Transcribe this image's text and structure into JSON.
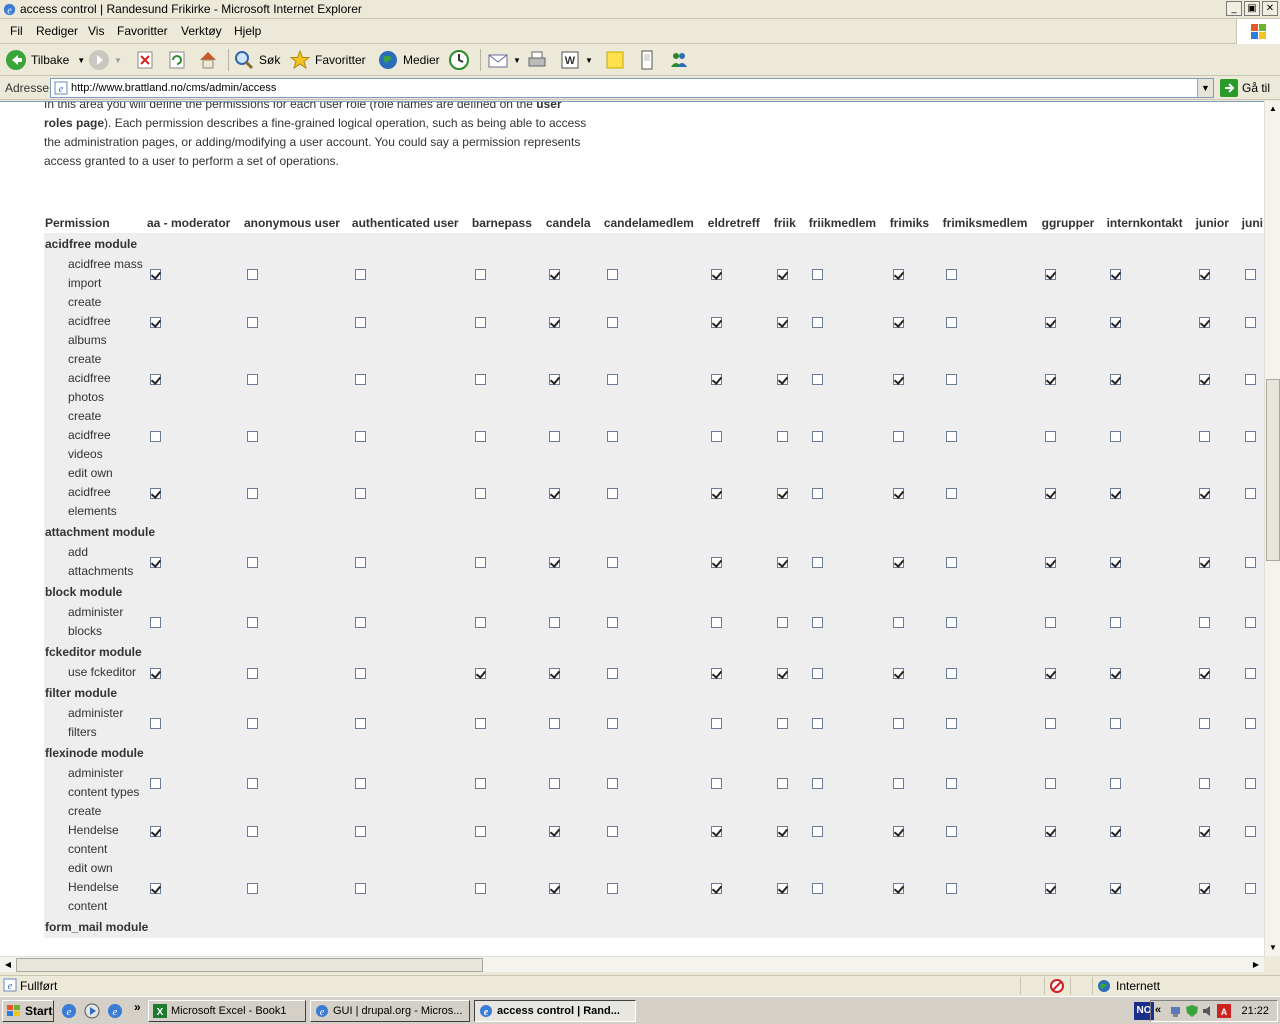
{
  "window": {
    "title": "access control | Randesund Frikirke - Microsoft Internet Explorer",
    "min_glyph": "_",
    "max_glyph": "▣",
    "close_glyph": "✕"
  },
  "menubar": {
    "items": [
      "Fil",
      "Rediger",
      "Vis",
      "Favoritter",
      "Verktøy",
      "Hjelp"
    ]
  },
  "toolbar": {
    "back_label": "Tilbake",
    "search_label": "Søk",
    "favorites_label": "Favoritter",
    "media_label": "Medier"
  },
  "address": {
    "label": "Adresse",
    "url": "http://www.brattland.no/cms/admin/access",
    "go_label": "Gå til"
  },
  "intro": {
    "line1_a": "In this area you will define the permissions for each user role (role names are defined on the ",
    "line1_link": "user roles page",
    "line1_b": "). Each permission describes a fine-grained logical operation, such as being able to access the administration pages, or adding/modifying a user account. You could say a permission represents access granted to a user to perform a set of operations."
  },
  "table": {
    "permission_header": "Permission",
    "roles": [
      "aa - moderator",
      "anonymous user",
      "authenticated user",
      "barnepass",
      "candela",
      "candelamedlem",
      "eldretreff",
      "friik",
      "friikmedlem",
      "frimiks",
      "frimiksmedlem",
      "ggrupper",
      "internkontakt",
      "junior",
      "juni"
    ],
    "modules": [
      {
        "name": "acidfree module",
        "perms": [
          {
            "label": "acidfree mass import",
            "checks": [
              1,
              0,
              0,
              0,
              1,
              0,
              1,
              1,
              0,
              1,
              0,
              1,
              1,
              1,
              0
            ]
          },
          {
            "label": "create acidfree albums",
            "checks": [
              1,
              0,
              0,
              0,
              1,
              0,
              1,
              1,
              0,
              1,
              0,
              1,
              1,
              1,
              0
            ]
          },
          {
            "label": "create acidfree photos",
            "checks": [
              1,
              0,
              0,
              0,
              1,
              0,
              1,
              1,
              0,
              1,
              0,
              1,
              1,
              1,
              0
            ]
          },
          {
            "label": "create acidfree videos",
            "checks": [
              0,
              0,
              0,
              0,
              0,
              0,
              0,
              0,
              0,
              0,
              0,
              0,
              0,
              0,
              0
            ]
          },
          {
            "label": "edit own acidfree elements",
            "checks": [
              1,
              0,
              0,
              0,
              1,
              0,
              1,
              1,
              0,
              1,
              0,
              1,
              1,
              1,
              0
            ]
          }
        ]
      },
      {
        "name": "attachment module",
        "perms": [
          {
            "label": "add attachments",
            "checks": [
              1,
              0,
              0,
              0,
              1,
              0,
              1,
              1,
              0,
              1,
              0,
              1,
              1,
              1,
              0
            ]
          }
        ]
      },
      {
        "name": "block module",
        "perms": [
          {
            "label": "administer blocks",
            "checks": [
              0,
              0,
              0,
              0,
              0,
              0,
              0,
              0,
              0,
              0,
              0,
              0,
              0,
              0,
              0
            ]
          }
        ]
      },
      {
        "name": "fckeditor module",
        "perms": [
          {
            "label": "use fckeditor",
            "checks": [
              1,
              0,
              0,
              1,
              1,
              0,
              1,
              1,
              0,
              1,
              0,
              1,
              1,
              1,
              0
            ]
          }
        ]
      },
      {
        "name": "filter module",
        "perms": [
          {
            "label": "administer filters",
            "checks": [
              0,
              0,
              0,
              0,
              0,
              0,
              0,
              0,
              0,
              0,
              0,
              0,
              0,
              0,
              0
            ]
          }
        ]
      },
      {
        "name": "flexinode module",
        "perms": [
          {
            "label": "administer content types",
            "checks": [
              0,
              0,
              0,
              0,
              0,
              0,
              0,
              0,
              0,
              0,
              0,
              0,
              0,
              0,
              0
            ]
          },
          {
            "label": "create Hendelse content",
            "checks": [
              1,
              0,
              0,
              0,
              1,
              0,
              1,
              1,
              0,
              1,
              0,
              1,
              1,
              1,
              0
            ]
          },
          {
            "label": "edit own Hendelse content",
            "checks": [
              1,
              0,
              0,
              0,
              1,
              0,
              1,
              1,
              0,
              1,
              0,
              1,
              1,
              1,
              0
            ]
          }
        ]
      },
      {
        "name": "form_mail module",
        "perms": []
      }
    ]
  },
  "status": {
    "text": "Fullført",
    "zone": "Internett"
  },
  "taskbar": {
    "start_label": "Start",
    "quick_more": "»",
    "tasks": [
      "Microsoft Excel - Book1",
      "GUI | drupal.org - Micros...",
      "access control | Rand..."
    ],
    "lang": "NO",
    "tray_more": "«",
    "clock": "21:22"
  },
  "colors": {
    "window_chrome": "#ece9d8",
    "table_row_bg": "#eeeeee",
    "text": "#333333",
    "taskbar": "#d4d0c8"
  }
}
